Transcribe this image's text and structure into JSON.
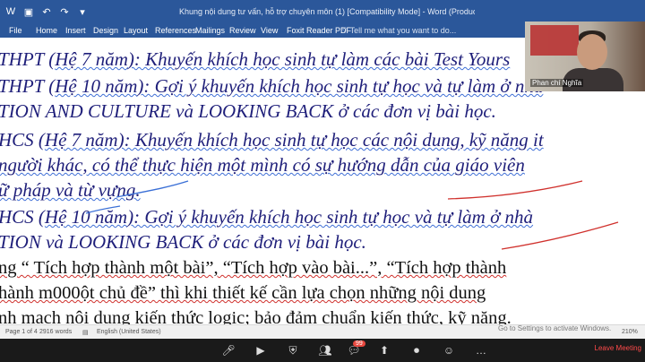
{
  "window": {
    "title": "Khung nội dung tư vấn, hỗ trợ chuyên môn (1) [Compatibility Mode] - Word (Product Activation Failed)"
  },
  "ribbon": {
    "tabs": [
      "File",
      "Home",
      "Insert",
      "Design",
      "Layout",
      "References",
      "Mailings",
      "Review",
      "View",
      "Foxit Reader PDF"
    ],
    "tellme": "Tell me what you want to do..."
  },
  "document": {
    "lines": [
      {
        "segments": [
          {
            "t": "THPT (",
            "s": "n"
          },
          {
            "t": "Hệ 7 năm",
            "s": "u"
          },
          {
            "t": "): Khuyến khích học sinh tự làm các bài Test Yours",
            "s": "u"
          }
        ]
      },
      {
        "segments": [
          {
            "t": "THPT (",
            "s": "n"
          },
          {
            "t": "Hệ 10 năm",
            "s": "u"
          },
          {
            "t": "): Gợi ý khuyến khích học sinh tự học và tự làm ở nhà",
            "s": "u"
          }
        ]
      },
      {
        "segments": [
          {
            "t": "TION AND CULTURE và LOOKING BACK ở các đơn vị bài học.",
            "s": "n"
          }
        ]
      },
      {
        "segments": [
          {
            "t": "HCS (",
            "s": "n"
          },
          {
            "t": "Hệ 7 năm",
            "s": "u"
          },
          {
            "t": "): Khuyến khích học sinh tự học các nội dung, kỹ năng it",
            "s": "u"
          }
        ]
      },
      {
        "segments": [
          {
            "t": " người khác, có thể thực hiện một mình có sự hướng dẫn của giáo viên",
            "s": "u"
          }
        ]
      },
      {
        "segments": [
          {
            "t": "ữ pháp và từ vựng.",
            "s": "u"
          }
        ]
      },
      {
        "segments": [
          {
            "t": "HCS (",
            "s": "n"
          },
          {
            "t": "Hệ 10 năm",
            "s": "u"
          },
          {
            "t": "): Gợi ý khuyến khích học sinh tự học và tự làm ở nhà",
            "s": "u"
          }
        ]
      },
      {
        "segments": [
          {
            "t": "TION và LOOKING BACK ở các đơn vị bài học.",
            "s": "n"
          }
        ]
      },
      {
        "segments": [
          {
            "t": "ng “ Tích hợp thành một bài”, “Tích hợp vào bài...”, “Tích hợp thành",
            "s": "r"
          }
        ]
      },
      {
        "segments": [
          {
            "t": "hành m000ột chủ đề” thì khi thiết kế cần lựa chọn những nội dung",
            "s": "r"
          }
        ]
      },
      {
        "segments": [
          {
            "t": "nh mạch nội dung kiến thức logic; bảo đảm chuẩn kiến thức, kỹ năng.",
            "s": "r"
          }
        ]
      }
    ]
  },
  "status": {
    "page": "Page 1 of 4",
    "words": "2916 words",
    "language": "English (United States)",
    "activate": "Go to Settings to activate Windows.",
    "zoom": "210%"
  },
  "zoom_meeting": {
    "participant_name": "Phan chí Nghĩa",
    "chat_badge": "99",
    "leave_label": "Leave Meeting"
  },
  "colors": {
    "word_blue": "#2b579a",
    "ink_blue": "#1f1f7a",
    "annotation_red": "#d0312d",
    "annotation_blue": "#3a6fd6"
  }
}
